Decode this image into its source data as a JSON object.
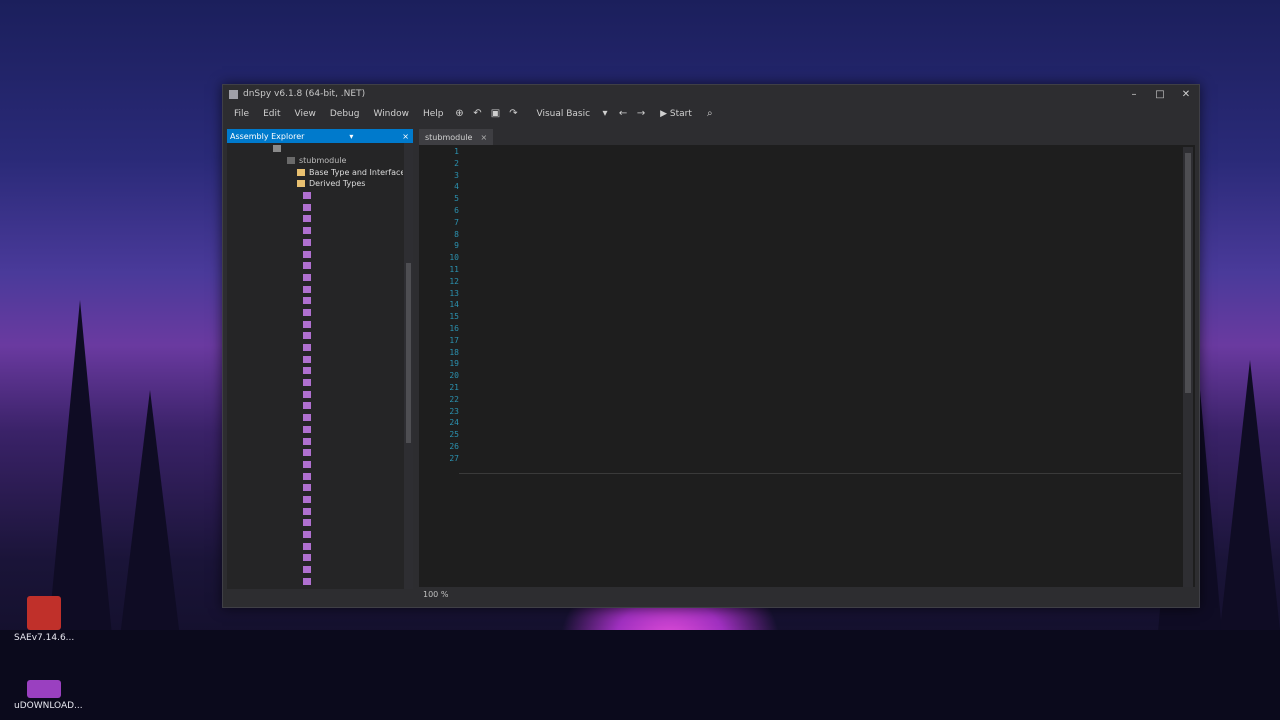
{
  "window": {
    "title": "dnSpy v6.1.8 (64-bit, .NET)",
    "controls": [
      "–",
      "□",
      "✕"
    ]
  },
  "menu": [
    "File",
    "Edit",
    "View",
    "Debug",
    "Window",
    "Help"
  ],
  "toolbar": {
    "language": "Visual Basic",
    "start_label": "Start"
  },
  "assembly_explorer": {
    "title": "Assembly Explorer",
    "footer": "",
    "nodes": [
      {
        "label": "",
        "indent": 46,
        "color": "#7a7a7a",
        "icon": "#8a8a8a"
      },
      {
        "label": "stubmodule",
        "indent": 60,
        "color": "#bdbdbd",
        "icon": "#6a6a6a"
      },
      {
        "label": "Base Type and Interfaces",
        "indent": 70,
        "color": "#dcdcdc",
        "icon": "#e8c070"
      },
      {
        "label": "Derived Types",
        "indent": 70,
        "color": "#dcdcdc",
        "icon": "#e8c070"
      },
      {
        "label": "",
        "indent": 76,
        "color": "#d9a366",
        "icon": "#b070d0"
      },
      {
        "label": "",
        "indent": 76,
        "color": "#d9a366",
        "icon": "#b070d0"
      },
      {
        "label": "",
        "indent": 76,
        "color": "#d9a366",
        "icon": "#b070d0"
      },
      {
        "label": "",
        "indent": 76,
        "color": "#d9a366",
        "icon": "#b070d0"
      },
      {
        "label": "",
        "indent": 76,
        "color": "#d9a366",
        "icon": "#b070d0"
      },
      {
        "label": "",
        "indent": 76,
        "color": "#d9a366",
        "icon": "#b070d0"
      },
      {
        "label": "",
        "indent": 76,
        "color": "#d9a366",
        "icon": "#b070d0"
      },
      {
        "label": "",
        "indent": 76,
        "color": "#d9a366",
        "icon": "#b070d0"
      },
      {
        "label": "",
        "indent": 76,
        "color": "#d9a366",
        "icon": "#b070d0"
      },
      {
        "label": "",
        "indent": 76,
        "color": "#d9a366",
        "icon": "#b070d0"
      },
      {
        "label": "",
        "indent": 76,
        "color": "#d9a366",
        "icon": "#b070d0"
      },
      {
        "label": "",
        "indent": 76,
        "color": "#d9a366",
        "icon": "#b070d0"
      },
      {
        "label": "",
        "indent": 76,
        "color": "#d9a366",
        "icon": "#b070d0"
      },
      {
        "label": "",
        "indent": 76,
        "color": "#d9a366",
        "icon": "#b070d0"
      },
      {
        "label": "",
        "indent": 76,
        "color": "#d9a366",
        "icon": "#b070d0"
      },
      {
        "label": "",
        "indent": 76,
        "color": "#d9a366",
        "icon": "#b070d0"
      },
      {
        "label": "",
        "indent": 76,
        "color": "#d9a366",
        "icon": "#b070d0"
      },
      {
        "label": "",
        "indent": 76,
        "color": "#d9a366",
        "icon": "#b070d0"
      },
      {
        "label": "",
        "indent": 76,
        "color": "#d9a366",
        "icon": "#b070d0"
      },
      {
        "label": "",
        "indent": 76,
        "color": "#d9a366",
        "icon": "#b070d0"
      },
      {
        "label": "",
        "indent": 76,
        "color": "#d9a366",
        "icon": "#b070d0"
      },
      {
        "label": "",
        "indent": 76,
        "color": "#d9a366",
        "icon": "#b070d0"
      },
      {
        "label": "",
        "indent": 76,
        "color": "#d9a366",
        "icon": "#b070d0"
      },
      {
        "label": "",
        "indent": 76,
        "color": "#d9a366",
        "icon": "#b070d0"
      },
      {
        "label": "",
        "indent": 76,
        "color": "#d9a366",
        "icon": "#b070d0"
      },
      {
        "label": "",
        "indent": 76,
        "color": "#d9a366",
        "icon": "#b070d0"
      },
      {
        "label": "",
        "indent": 76,
        "color": "#d9a366",
        "icon": "#b070d0"
      },
      {
        "label": "",
        "indent": 76,
        "color": "#d9a366",
        "icon": "#b070d0"
      },
      {
        "label": "",
        "indent": 76,
        "color": "#d9a366",
        "icon": "#b070d0"
      },
      {
        "label": "",
        "indent": 76,
        "color": "#d9a366",
        "icon": "#b070d0"
      },
      {
        "label": "",
        "indent": 76,
        "color": "#d9a366",
        "icon": "#b070d0"
      },
      {
        "label": "",
        "indent": 76,
        "color": "#d9a366",
        "icon": "#b070d0"
      },
      {
        "label": "",
        "indent": 76,
        "color": "#d9a366",
        "icon": "#b070d0"
      },
      {
        "label": "",
        "indent": 76,
        "color": "#d9a366",
        "icon": "#b070d0"
      }
    ]
  },
  "editor": {
    "tab_label": "stubmodule",
    "zoom": "100 %",
    "line_numbers": [
      "1",
      "2",
      "3",
      "4",
      "5",
      "6",
      "7",
      "8",
      "9",
      "10",
      "11",
      "12",
      "13",
      "14",
      "15",
      "16",
      "17",
      "18",
      "19",
      "20",
      "21",
      "22",
      "23",
      "24",
      "25",
      "26",
      "27"
    ],
    "code_lines": [
      "",
      "",
      "",
      "",
      "",
      "",
      "",
      "",
      "",
      "",
      "",
      "",
      "",
      "",
      "",
      "",
      "",
      "",
      "",
      "",
      "",
      "",
      "",
      "",
      "",
      "",
      ""
    ]
  },
  "desktop_icons": [
    {
      "label": "SAEv7.14.6...",
      "color": "#c0302a"
    },
    {
      "label": "uDOWNLOAD...",
      "color": "#9a40c0"
    }
  ],
  "colors": {
    "accent": "#007acc",
    "editor_bg": "#1e1e1e",
    "panel_bg": "#252526",
    "chrome": "#2d2d30"
  }
}
